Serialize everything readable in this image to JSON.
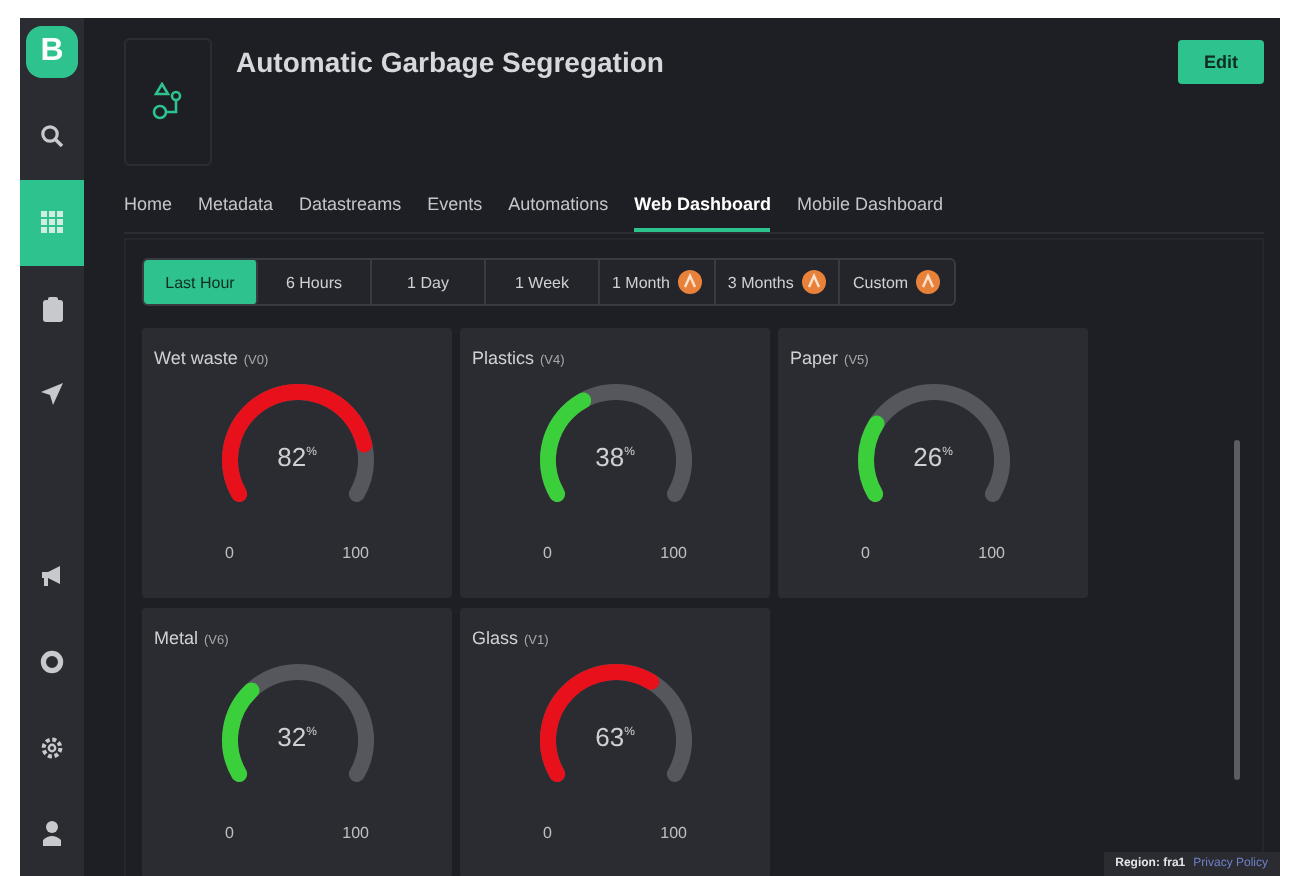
{
  "sidebar": {
    "logo": "B",
    "items": [
      {
        "kind": "search",
        "selected": false
      },
      {
        "kind": "grid",
        "selected": true
      },
      {
        "kind": "clipboard",
        "selected": false
      },
      {
        "kind": "send",
        "selected": false
      },
      {
        "kind": "megaphone",
        "selected": false
      },
      {
        "kind": "lifebuoy",
        "selected": false
      },
      {
        "kind": "gear",
        "selected": false
      },
      {
        "kind": "person",
        "selected": false
      }
    ]
  },
  "header": {
    "title": "Automatic Garbage Segregation",
    "edit_button": "Edit"
  },
  "tabs": [
    {
      "label": "Home",
      "selected": false
    },
    {
      "label": "Metadata",
      "selected": false
    },
    {
      "label": "Datastreams",
      "selected": false
    },
    {
      "label": "Events",
      "selected": false
    },
    {
      "label": "Automations",
      "selected": false
    },
    {
      "label": "Web Dashboard",
      "selected": true
    },
    {
      "label": "Mobile Dashboard",
      "selected": false
    }
  ],
  "time_ranges": [
    {
      "label": "Last Hour",
      "selected": true,
      "premium": false
    },
    {
      "label": "6 Hours",
      "selected": false,
      "premium": false
    },
    {
      "label": "1 Day",
      "selected": false,
      "premium": false
    },
    {
      "label": "1 Week",
      "selected": false,
      "premium": false
    },
    {
      "label": "1 Month",
      "selected": false,
      "premium": true
    },
    {
      "label": "3 Months",
      "selected": false,
      "premium": true
    },
    {
      "label": "Custom",
      "selected": false,
      "premium": true
    }
  ],
  "widgets": [
    {
      "title": "Wet waste",
      "pin": "(V0)",
      "value": "82",
      "unit": "%",
      "color": "#e8101a",
      "min": "0",
      "max": "100"
    },
    {
      "title": "Plastics",
      "pin": "(V4)",
      "value": "38",
      "unit": "%",
      "color": "#3ccf3c",
      "min": "0",
      "max": "100"
    },
    {
      "title": "Paper",
      "pin": "(V5)",
      "value": "26",
      "unit": "%",
      "color": "#3ccf3c",
      "min": "0",
      "max": "100"
    },
    {
      "title": "Metal",
      "pin": "(V6)",
      "value": "32",
      "unit": "%",
      "color": "#3ccf3c",
      "min": "0",
      "max": "100"
    },
    {
      "title": "Glass",
      "pin": "(V1)",
      "value": "63",
      "unit": "%",
      "color": "#e8101a",
      "min": "0",
      "max": "100"
    }
  ],
  "footer": {
    "region": "Region: fra1",
    "privacy_link": "Privacy Policy"
  }
}
